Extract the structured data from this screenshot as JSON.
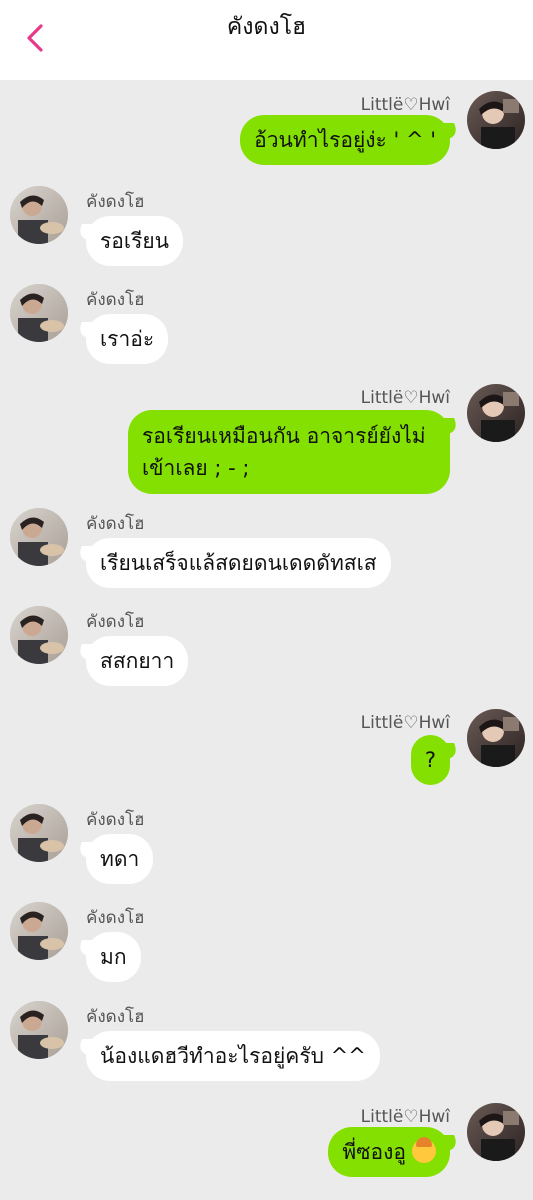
{
  "header": {
    "title": "คังดงโฮ",
    "back_icon": "chevron-left-icon",
    "accent": "#e8388a"
  },
  "colors": {
    "background": "#ebebeb",
    "incoming_bubble": "#ffffff",
    "outgoing_bubble": "#84e000"
  },
  "messages": [
    {
      "dir": "out",
      "sender": "Littlë♡Hwî",
      "text": "อ้วนทำไรอยู่ง่ะ ' ^ '"
    },
    {
      "dir": "in",
      "sender": "คังดงโฮ",
      "text": "รอเรียน"
    },
    {
      "dir": "in",
      "sender": "คังดงโฮ",
      "text": "เราอ่ะ"
    },
    {
      "dir": "out",
      "sender": "Littlë♡Hwî",
      "text_line1": "รอเรียนเหมือนกัน อาจารย์ยังไม่",
      "text_line2": "เข้าเลย ; - ;"
    },
    {
      "dir": "in",
      "sender": "คังดงโฮ",
      "text": "เรียนเสร็จแล้สดยดนเดดดัทสเส"
    },
    {
      "dir": "in",
      "sender": "คังดงโฮ",
      "text": "สสกยาา"
    },
    {
      "dir": "out",
      "sender": "Littlë♡Hwî",
      "text": "?"
    },
    {
      "dir": "in",
      "sender": "คังดงโฮ",
      "text": "ทดา"
    },
    {
      "dir": "in",
      "sender": "คังดงโฮ",
      "text": "มก"
    },
    {
      "dir": "in",
      "sender": "คังดงโฮ",
      "text": "น้องแดฮวีทำอะไรอยู่ครับ ^^"
    },
    {
      "dir": "out",
      "sender": "Littlë♡Hwî",
      "text": "พี่ซองอู",
      "emoji": "person-gesturing-ok-emoji"
    }
  ]
}
